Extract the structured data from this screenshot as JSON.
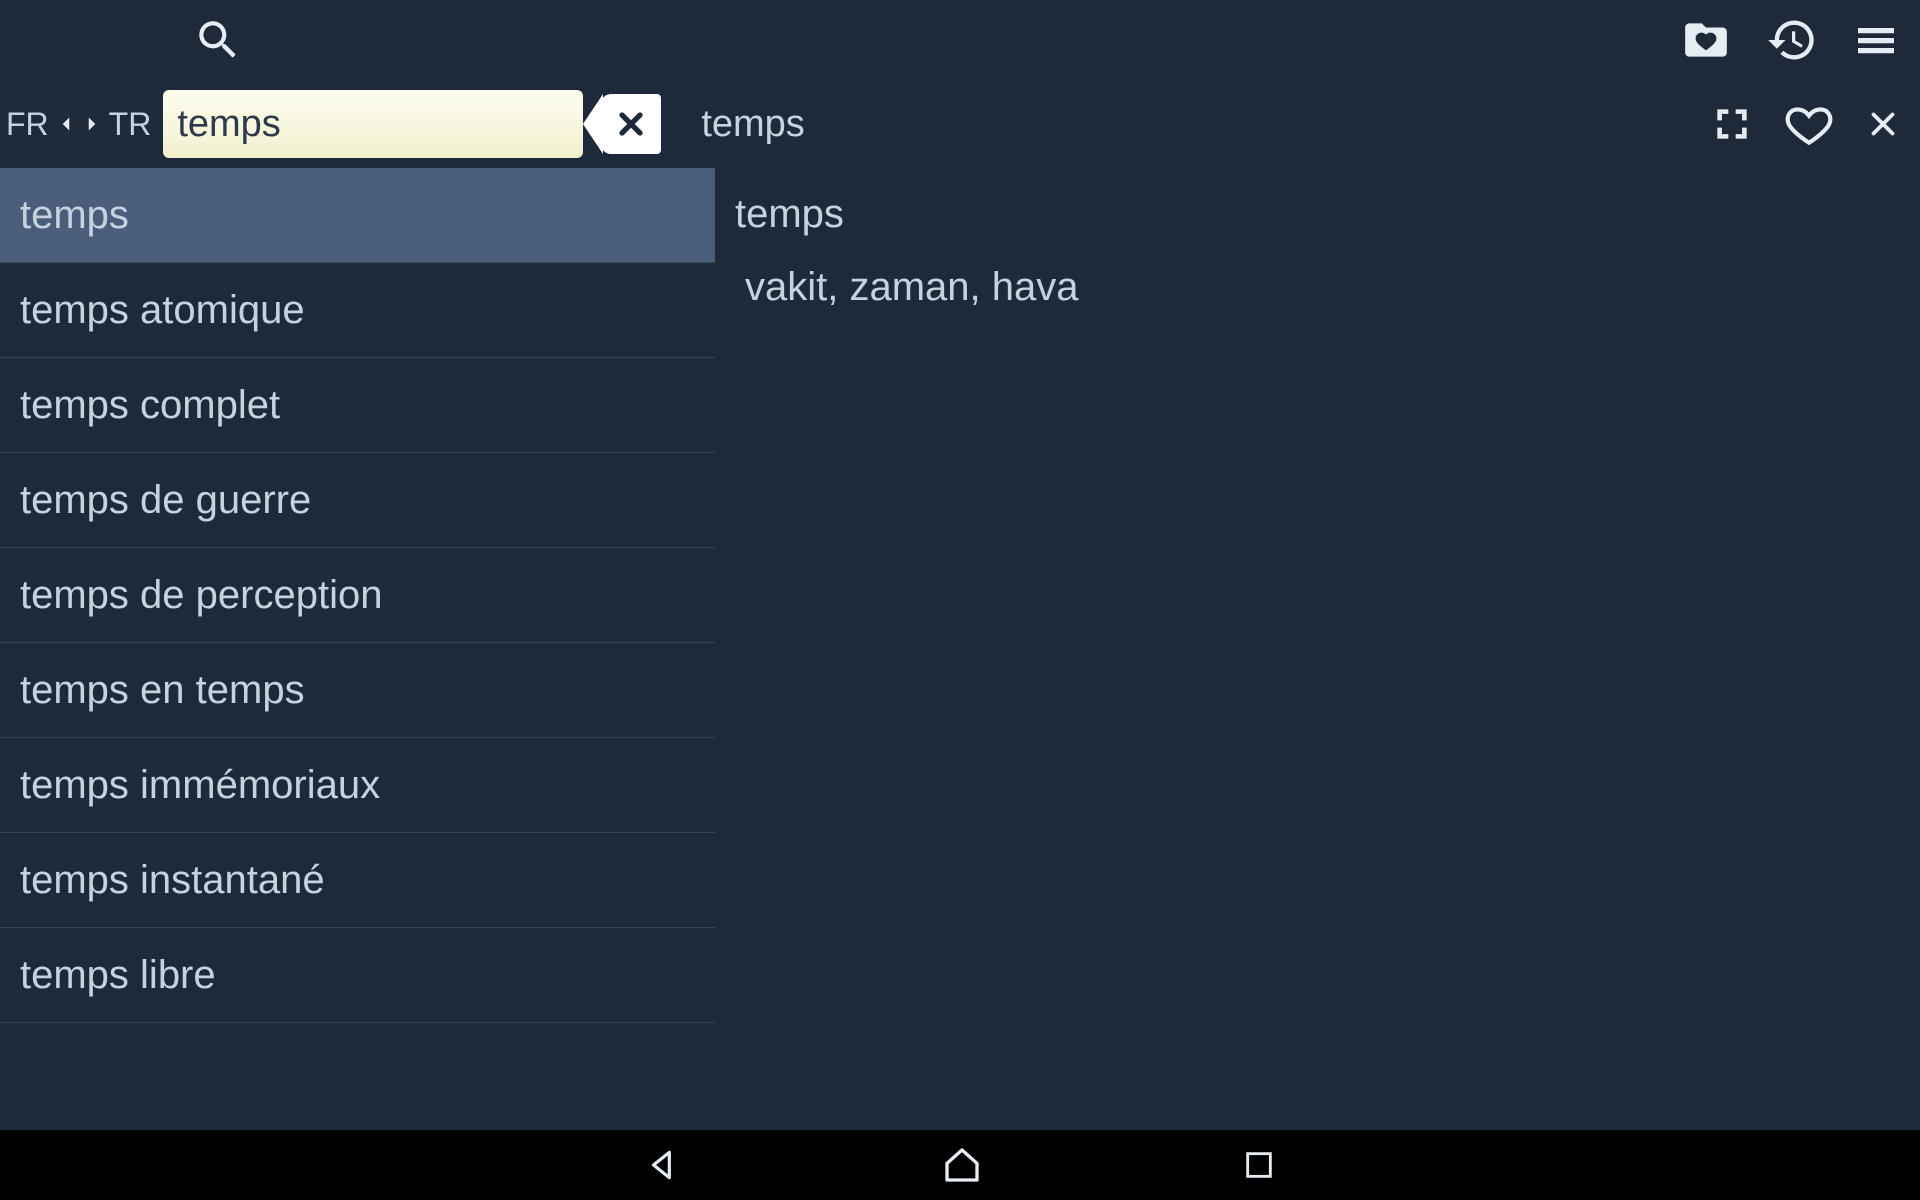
{
  "lang": {
    "from": "FR",
    "to": "TR"
  },
  "search": {
    "value": "temps"
  },
  "list": {
    "selectedIndex": 0,
    "items": [
      "temps",
      "temps atomique",
      "temps complet",
      "temps de guerre",
      "temps de perception",
      "temps en temps",
      "temps immémoriaux",
      "temps instantané",
      "temps libre"
    ]
  },
  "detail": {
    "title": "temps",
    "term": "temps",
    "translation": "vakit, zaman, hava"
  }
}
